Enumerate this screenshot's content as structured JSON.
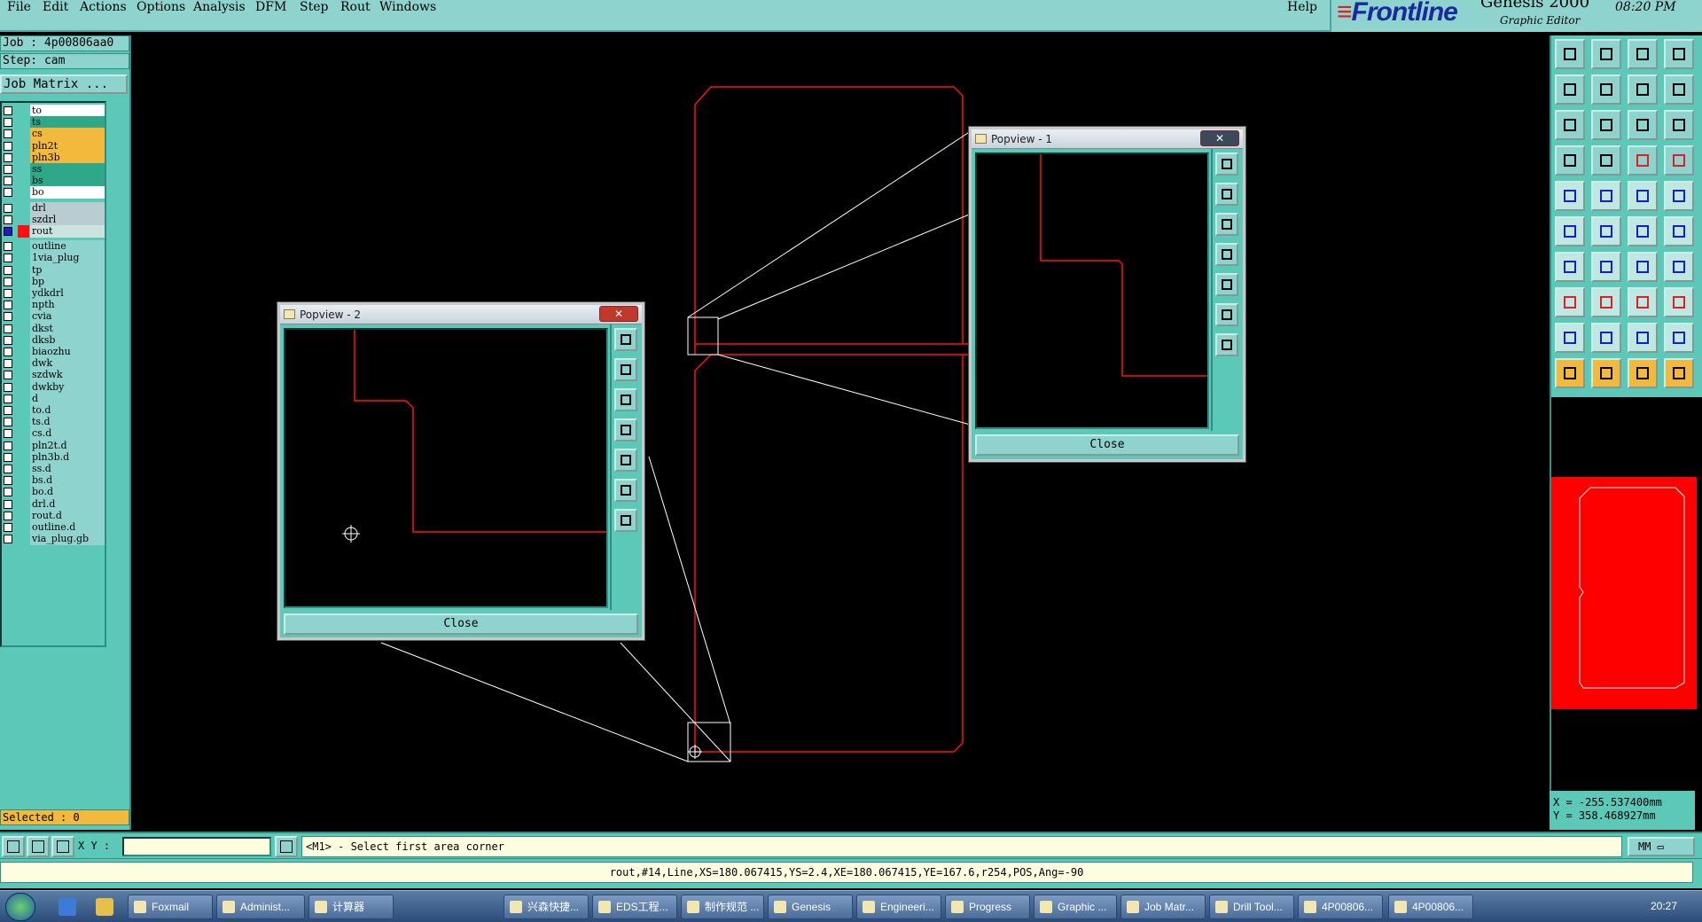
{
  "menu": [
    "File",
    "Edit",
    "Actions",
    "Options",
    "Analysis",
    "DFM",
    "Step",
    "Rout",
    "Windows"
  ],
  "help": "Help",
  "brand": {
    "logo": "Frontline",
    "product": "Genesis 2000",
    "subtitle": "Graphic Editor",
    "clock": "08:20 PM"
  },
  "job": {
    "job_label": "Job : 4p00806aa0",
    "step_label": "Step: cam",
    "matrix_button": "Job Matrix ..."
  },
  "layers": [
    {
      "name": "to",
      "color": "#ffffff",
      "checked": false
    },
    {
      "name": "ts",
      "color": "#2fa88a",
      "checked": false
    },
    {
      "name": "cs",
      "color": "#f3b93c",
      "checked": false
    },
    {
      "name": "pln2t",
      "color": "#f3b93c",
      "checked": false
    },
    {
      "name": "pln3b",
      "color": "#f3b93c",
      "checked": false
    },
    {
      "name": "ss",
      "color": "#2fa88a",
      "checked": false
    },
    {
      "name": "bs",
      "color": "#2fa88a",
      "checked": false
    },
    {
      "name": "bo",
      "color": "#ffffff",
      "checked": false
    },
    {
      "name": "drl",
      "color": "#b8cdd0",
      "checked": false
    },
    {
      "name": "szdrl",
      "color": "#b8cdd0",
      "checked": false
    },
    {
      "name": "rout",
      "color": "#cde3e0",
      "checked": true,
      "swatch": "#ff1010"
    },
    {
      "name": "outline",
      "color": "#8fd3cf",
      "checked": false
    },
    {
      "name": "1via_plug",
      "color": "#8fd3cf",
      "checked": false
    },
    {
      "name": "tp",
      "color": "#8fd3cf",
      "checked": false
    },
    {
      "name": "bp",
      "color": "#8fd3cf",
      "checked": false
    },
    {
      "name": "ydkdrl",
      "color": "#8fd3cf",
      "checked": false
    },
    {
      "name": "npth",
      "color": "#8fd3cf",
      "checked": false
    },
    {
      "name": "cvia",
      "color": "#8fd3cf",
      "checked": false
    },
    {
      "name": "dkst",
      "color": "#8fd3cf",
      "checked": false
    },
    {
      "name": "dksb",
      "color": "#8fd3cf",
      "checked": false
    },
    {
      "name": "biaozhu",
      "color": "#8fd3cf",
      "checked": false
    },
    {
      "name": "dwk",
      "color": "#8fd3cf",
      "checked": false
    },
    {
      "name": "szdwk",
      "color": "#8fd3cf",
      "checked": false
    },
    {
      "name": "dwkby",
      "color": "#8fd3cf",
      "checked": false
    },
    {
      "name": "d",
      "color": "#8fd3cf",
      "checked": false
    },
    {
      "name": "to.d",
      "color": "#8fd3cf",
      "checked": false
    },
    {
      "name": "ts.d",
      "color": "#8fd3cf",
      "checked": false
    },
    {
      "name": "cs.d",
      "color": "#8fd3cf",
      "checked": false
    },
    {
      "name": "pln2t.d",
      "color": "#8fd3cf",
      "checked": false
    },
    {
      "name": "pln3b.d",
      "color": "#8fd3cf",
      "checked": false
    },
    {
      "name": "ss.d",
      "color": "#8fd3cf",
      "checked": false
    },
    {
      "name": "bs.d",
      "color": "#8fd3cf",
      "checked": false
    },
    {
      "name": "bo.d",
      "color": "#8fd3cf",
      "checked": false
    },
    {
      "name": "drl.d",
      "color": "#8fd3cf",
      "checked": false
    },
    {
      "name": "rout.d",
      "color": "#8fd3cf",
      "checked": false
    },
    {
      "name": "outline.d",
      "color": "#8fd3cf",
      "checked": false
    },
    {
      "name": "via_plug.gb",
      "color": "#8fd3cf",
      "checked": false
    }
  ],
  "selected": "Selected : 0",
  "popview1": {
    "title": "Popview - 1",
    "close_label": "Close"
  },
  "popview2": {
    "title": "Popview - 2",
    "close_label": "Close"
  },
  "coords": {
    "x": "X = -255.537400mm",
    "y": "Y = 358.468927mm"
  },
  "command": {
    "xy_label": "X Y :",
    "xy_value": "",
    "prompt": "<M1> - Select first area corner",
    "units": "MM"
  },
  "status": "rout,#14,Line,XS=180.067415,YS=2.4,XE=180.067415,YE=167.6,r254,POS,Ang=-90",
  "taskbar": {
    "items": [
      "Foxmail",
      "Administ...",
      "计算器",
      "兴森快捷...",
      "EDS工程...",
      "制作规范 ...",
      "Genesis",
      "Engineeri...",
      "Progress",
      "Graphic ...",
      "Job Matr...",
      "Drill Tool...",
      "4P00806...",
      "4P00806..."
    ],
    "clock": "20:27"
  },
  "colors": {
    "panel": "#5bc8b8",
    "panel_light": "#8fd3cf",
    "rout": "#ff1010",
    "highlight": "#f3b93c"
  }
}
